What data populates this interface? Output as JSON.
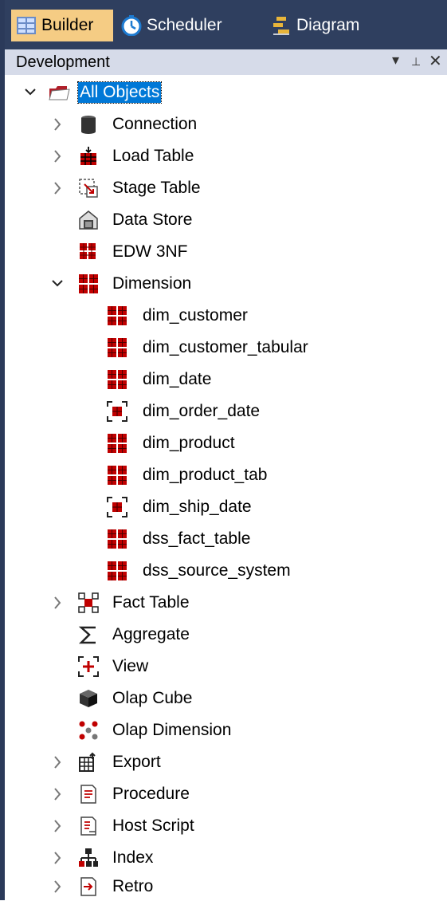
{
  "tabs": [
    {
      "label": "Builder",
      "icon": "builder-icon",
      "active": true
    },
    {
      "label": "Scheduler",
      "icon": "clock-icon",
      "active": false
    },
    {
      "label": "Diagram",
      "icon": "diagram-icon",
      "active": false
    }
  ],
  "panel": {
    "title": "Development",
    "dropdown_glyph": "▾",
    "pin_glyph": "⊥",
    "close_glyph": "✕"
  },
  "tree": {
    "root": {
      "label": "All Objects",
      "expanded": true,
      "selected": true
    },
    "children": [
      {
        "label": "Connection",
        "icon": "connection-icon",
        "expander": "collapsed"
      },
      {
        "label": "Load Table",
        "icon": "load-table-icon",
        "expander": "collapsed"
      },
      {
        "label": "Stage Table",
        "icon": "stage-table-icon",
        "expander": "collapsed"
      },
      {
        "label": "Data Store",
        "icon": "data-store-icon",
        "expander": "none"
      },
      {
        "label": "EDW 3NF",
        "icon": "edw-3nf-icon",
        "expander": "none"
      },
      {
        "label": "Dimension",
        "icon": "dimension-icon",
        "expander": "expanded",
        "children": [
          {
            "label": "dim_customer",
            "icon": "dimension-table-icon"
          },
          {
            "label": "dim_customer_tabular",
            "icon": "dimension-table-icon"
          },
          {
            "label": "dim_date",
            "icon": "dimension-table-icon"
          },
          {
            "label": "dim_order_date",
            "icon": "dimension-view-icon"
          },
          {
            "label": "dim_product",
            "icon": "dimension-table-icon"
          },
          {
            "label": "dim_product_tab",
            "icon": "dimension-table-icon"
          },
          {
            "label": "dim_ship_date",
            "icon": "dimension-view-icon"
          },
          {
            "label": "dss_fact_table",
            "icon": "dimension-table-icon"
          },
          {
            "label": "dss_source_system",
            "icon": "dimension-table-icon"
          }
        ]
      },
      {
        "label": "Fact Table",
        "icon": "fact-table-icon",
        "expander": "collapsed"
      },
      {
        "label": "Aggregate",
        "icon": "sigma-icon",
        "expander": "none"
      },
      {
        "label": "View",
        "icon": "view-icon",
        "expander": "none"
      },
      {
        "label": "Olap Cube",
        "icon": "olap-cube-icon",
        "expander": "none"
      },
      {
        "label": "Olap Dimension",
        "icon": "olap-dimension-icon",
        "expander": "none"
      },
      {
        "label": "Export",
        "icon": "export-icon",
        "expander": "collapsed"
      },
      {
        "label": "Procedure",
        "icon": "procedure-icon",
        "expander": "collapsed"
      },
      {
        "label": "Host Script",
        "icon": "host-script-icon",
        "expander": "collapsed"
      },
      {
        "label": "Index",
        "icon": "index-icon",
        "expander": "collapsed"
      },
      {
        "label": "Retro",
        "icon": "retro-icon",
        "expander": "collapsed"
      }
    ]
  },
  "colors": {
    "tab_bar_bg": "#2f3f5f",
    "active_tab_bg": "#f5cc84",
    "panel_header_bg": "#d6dbe9",
    "selection_bg": "#0078d7",
    "icon_red": "#c00000"
  }
}
